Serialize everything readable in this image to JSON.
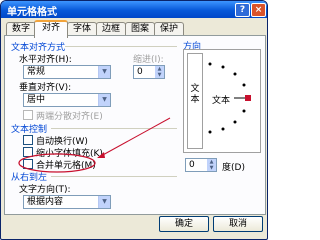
{
  "window": {
    "title": "单元格格式",
    "help_glyph": "?",
    "close_glyph": "×"
  },
  "tabs": [
    {
      "label": "数字"
    },
    {
      "label": "对齐"
    },
    {
      "label": "字体"
    },
    {
      "label": "边框"
    },
    {
      "label": "图案"
    },
    {
      "label": "保护"
    }
  ],
  "alignment": {
    "group_label": "文本对齐方式",
    "horizontal_label": "水平对齐(H):",
    "horizontal_value": "常规",
    "indent_label": "缩进(I):",
    "indent_value": "0",
    "vertical_label": "垂直对齐(V):",
    "vertical_value": "居中",
    "distributed_label": "两端分散对齐(E)"
  },
  "text_control": {
    "group_label": "文本控制",
    "wrap_label": "自动换行(W)",
    "shrink_label": "缩小字体填充(K)",
    "merge_label": "合并单元格(M)"
  },
  "rtl": {
    "group_label": "从右到左",
    "direction_label": "文字方向(T):",
    "direction_value": "根据内容"
  },
  "orientation": {
    "group_label": "方向",
    "vertical_text": "文本",
    "dial_text": "文本",
    "degrees_value": "0",
    "degrees_label": "度(D)"
  },
  "buttons": {
    "ok": "确定",
    "cancel": "取消"
  },
  "annotation_color": "#c8102e"
}
